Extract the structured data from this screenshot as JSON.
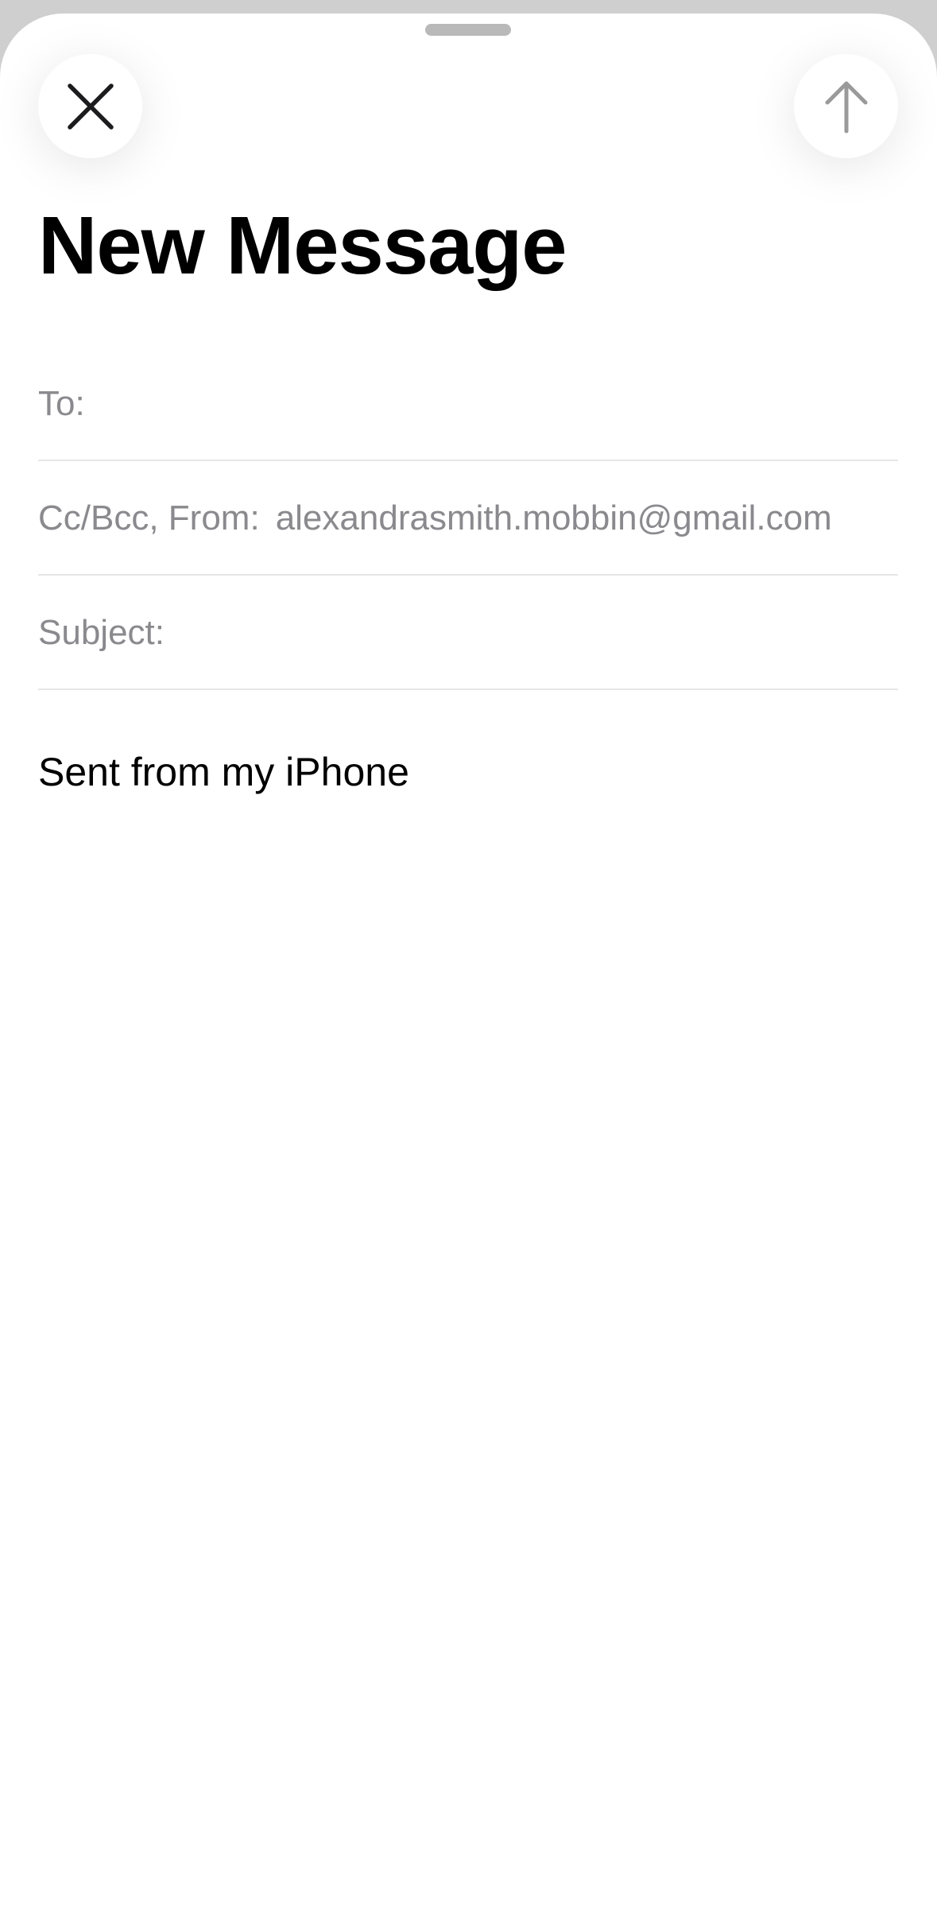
{
  "sheet": {
    "title": "New Message"
  },
  "toolbar": {
    "close_icon": "close-icon",
    "send_icon": "arrow-up-icon"
  },
  "fields": {
    "to_label": "To:",
    "ccbcc_label": "Cc/Bcc, From:",
    "from_value": "alexandrasmith.mobbin@gmail.com",
    "subject_label": "Subject:"
  },
  "body": {
    "signature": "Sent from my iPhone"
  },
  "colors": {
    "background_dim": "#cfcfcf",
    "sheet": "#ffffff",
    "secondary_text": "#8a8a8e",
    "separator": "#e6e6e6",
    "send_disabled": "#9a9a9a"
  }
}
